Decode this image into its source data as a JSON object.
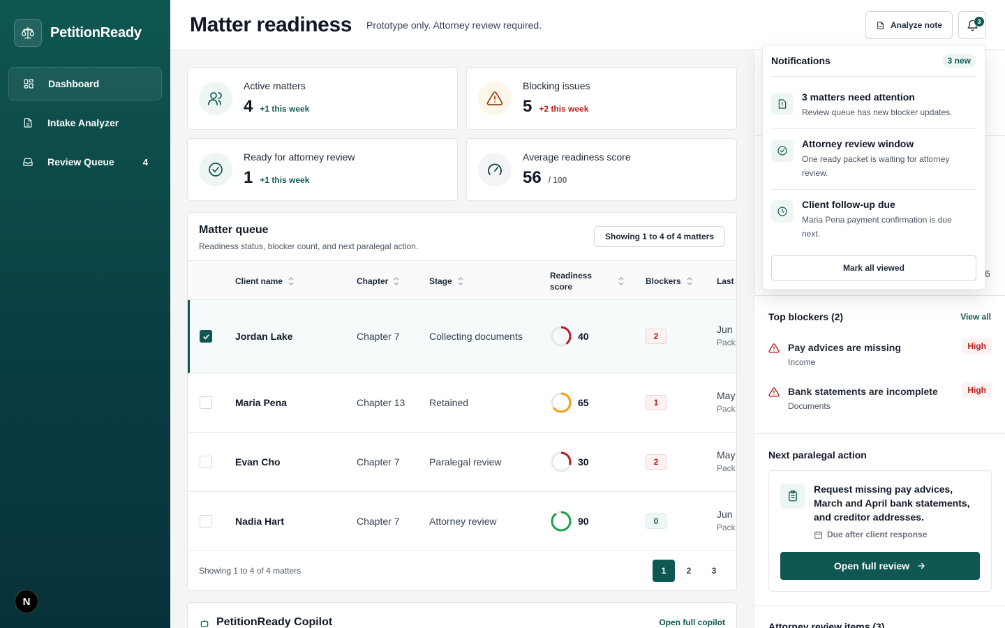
{
  "brand": {
    "name": "PetitionReady"
  },
  "sidebar": {
    "items": [
      {
        "label": "Dashboard",
        "icon": "dashboard-icon"
      },
      {
        "label": "Intake Analyzer",
        "icon": "document-icon"
      },
      {
        "label": "Review Queue",
        "icon": "inbox-icon",
        "count": "4"
      }
    ],
    "dev_badge": "N"
  },
  "header": {
    "title": "Matter readiness",
    "subtitle": "Prototype only. Attorney review required.",
    "analyze_label": "Analyze note",
    "notification_count": "3"
  },
  "stats": [
    {
      "label": "Active matters",
      "value": "4",
      "delta": "+1 this week",
      "icon": "users-icon",
      "tone": "#0f5752"
    },
    {
      "label": "Blocking issues",
      "value": "5",
      "delta": "+2 this week",
      "icon": "warning-icon",
      "tone": "#b91c1c"
    },
    {
      "label": "Ready for attorney review",
      "value": "1",
      "delta": "+1 this week",
      "icon": "check-circle-icon",
      "tone": "#0f5752"
    },
    {
      "label": "Average readiness score",
      "value": "56",
      "delta": "/ 100",
      "icon": "gauge-icon",
      "tone": "#6b7280"
    }
  ],
  "queue": {
    "title": "Matter queue",
    "subtitle": "Readiness status, blocker count, and next paralegal action.",
    "showing": "Showing 1 to 4 of 4 matters",
    "columns": {
      "client": "Client name",
      "chapter": "Chapter",
      "stage": "Stage",
      "score": "Readiness score",
      "blockers": "Blockers",
      "last": "Last"
    },
    "rows": [
      {
        "client": "Jordan Lake",
        "chapter": "Chapter 7",
        "stage": "Collecting documents",
        "score": 40,
        "score_label": "40",
        "blockers": "2",
        "last_date": "Jun",
        "last_detail": "Pack",
        "selected": true
      },
      {
        "client": "Maria Pena",
        "chapter": "Chapter 13",
        "stage": "Retained",
        "score": 65,
        "score_label": "65",
        "blockers": "1",
        "last_date": "May",
        "last_detail": "Pack",
        "selected": false
      },
      {
        "client": "Evan Cho",
        "chapter": "Chapter 7",
        "stage": "Paralegal review",
        "score": 30,
        "score_label": "30",
        "blockers": "2",
        "last_date": "May",
        "last_detail": "Pack",
        "selected": false
      },
      {
        "client": "Nadia Hart",
        "chapter": "Chapter 7",
        "stage": "Attorney review",
        "score": 90,
        "score_label": "90",
        "blockers": "0",
        "last_date": "Jun",
        "last_detail": "Pack",
        "selected": false
      }
    ],
    "footer": "Showing 1 to 4 of 4 matters",
    "pages": [
      "1",
      "2",
      "3"
    ],
    "current_page": "1"
  },
  "copilot": {
    "title": "PetitionReady Copilot",
    "open_label": "Open full copilot"
  },
  "right_panel": {
    "hidden_digit": "6",
    "top_blockers": {
      "title": "Top blockers (2)",
      "view_all": "View all",
      "items": [
        {
          "title": "Pay advices are missing",
          "category": "Income",
          "severity": "High"
        },
        {
          "title": "Bank statements are incomplete",
          "category": "Documents",
          "severity": "High"
        }
      ]
    },
    "next_action": {
      "title": "Next paralegal action",
      "text": "Request missing pay advices, March and April bank statements, and creditor addresses.",
      "due": "Due after client response",
      "button": "Open full review"
    },
    "attorney_items": {
      "title": "Attorney review items (3)"
    }
  },
  "notifications": {
    "title": "Notifications",
    "badge": "3 new",
    "items": [
      {
        "title": "3 matters need attention",
        "body": "Review queue has new blocker updates.",
        "icon": "alert-file-icon"
      },
      {
        "title": "Attorney review window",
        "body": "One ready packet is waiting for attorney review.",
        "icon": "check-circle-icon"
      },
      {
        "title": "Client follow-up due",
        "body": "Maria Pena payment confirmation is due next.",
        "icon": "clock-icon"
      }
    ],
    "mark_all": "Mark all viewed"
  },
  "colors": {
    "brand": "#0f5752",
    "danger": "#b91c1c",
    "warning": "#f59e0b",
    "success": "#16a34a"
  }
}
